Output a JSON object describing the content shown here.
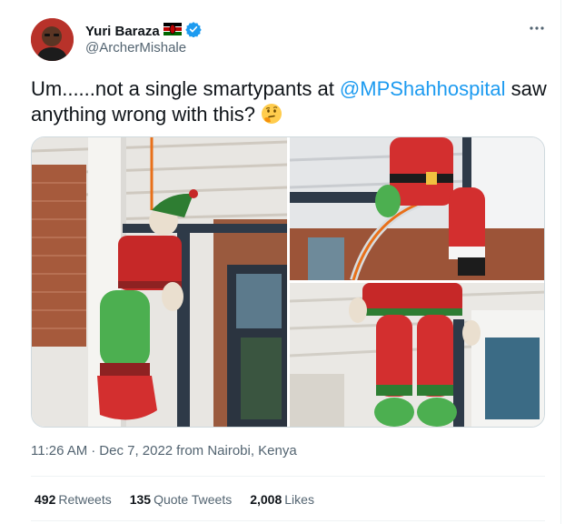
{
  "author": {
    "name": "Yuri Baraza",
    "handle": "@ArcherMishale",
    "flag": "kenya-flag-icon",
    "verified": "verified-badge-icon"
  },
  "tweet": {
    "text_before": "Um......not a single smartypants at ",
    "mention": "@MPShahhospital",
    "text_after": " saw anything wrong with this? ",
    "emoji": "thinking-face-icon"
  },
  "meta": {
    "time": "11:26 AM",
    "separator": "·",
    "date": "Dec 7, 2022",
    "source": "from Nairobi, Kenya"
  },
  "stats": [
    {
      "num": "492",
      "label": "Retweets"
    },
    {
      "num": "135",
      "label": "Quote Tweets"
    },
    {
      "num": "2,008",
      "label": "Likes"
    }
  ],
  "media": [
    {
      "icon": "hanging-elf-doll-photo"
    },
    {
      "icon": "hanging-santa-doll-photo"
    },
    {
      "icon": "hanging-elf-legs-photo"
    }
  ],
  "colors": {
    "link": "#1d9bf0",
    "secondary": "#536471",
    "text": "#0f1419"
  }
}
